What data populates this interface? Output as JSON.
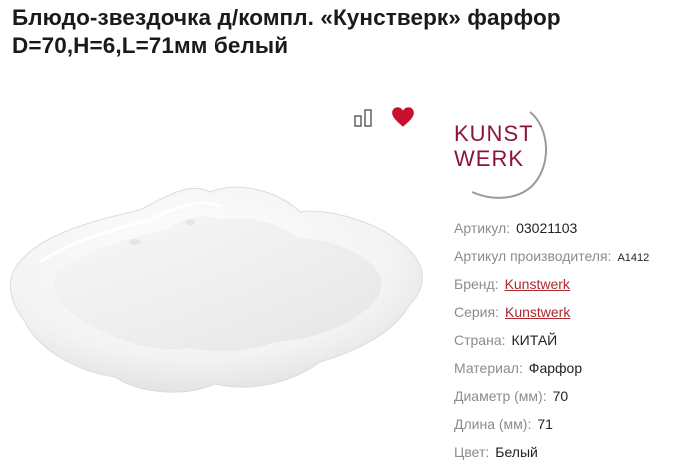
{
  "product": {
    "title_line1": "Блюдо-звездочка д/компл. «Кунстверк» фарфор",
    "title_line2": "D=70,H=6,L=71мм белый"
  },
  "actions": {
    "compare_icon": "compare-icon",
    "favorite_icon": "heart-icon",
    "favorite_color": "#c8102e"
  },
  "brand_logo": {
    "line1": "KUNST",
    "line2": "WERK",
    "color": "#8a1538"
  },
  "specs": {
    "article": {
      "label": "Артикул:",
      "value": "03021103"
    },
    "manufacturer_article": {
      "label": "Артикул производителя:",
      "value": "A1412"
    },
    "brand": {
      "label": "Бренд:",
      "value": "Kunstwerk"
    },
    "series": {
      "label": "Серия:",
      "value": "Kunstwerk"
    },
    "country": {
      "label": "Страна:",
      "value": "КИТАЙ"
    },
    "material": {
      "label": "Материал:",
      "value": "Фарфор"
    },
    "diameter": {
      "label": "Диаметр (мм):",
      "value": "70"
    },
    "length": {
      "label": "Длина (мм):",
      "value": "71"
    },
    "color": {
      "label": "Цвет:",
      "value": "Белый"
    }
  }
}
